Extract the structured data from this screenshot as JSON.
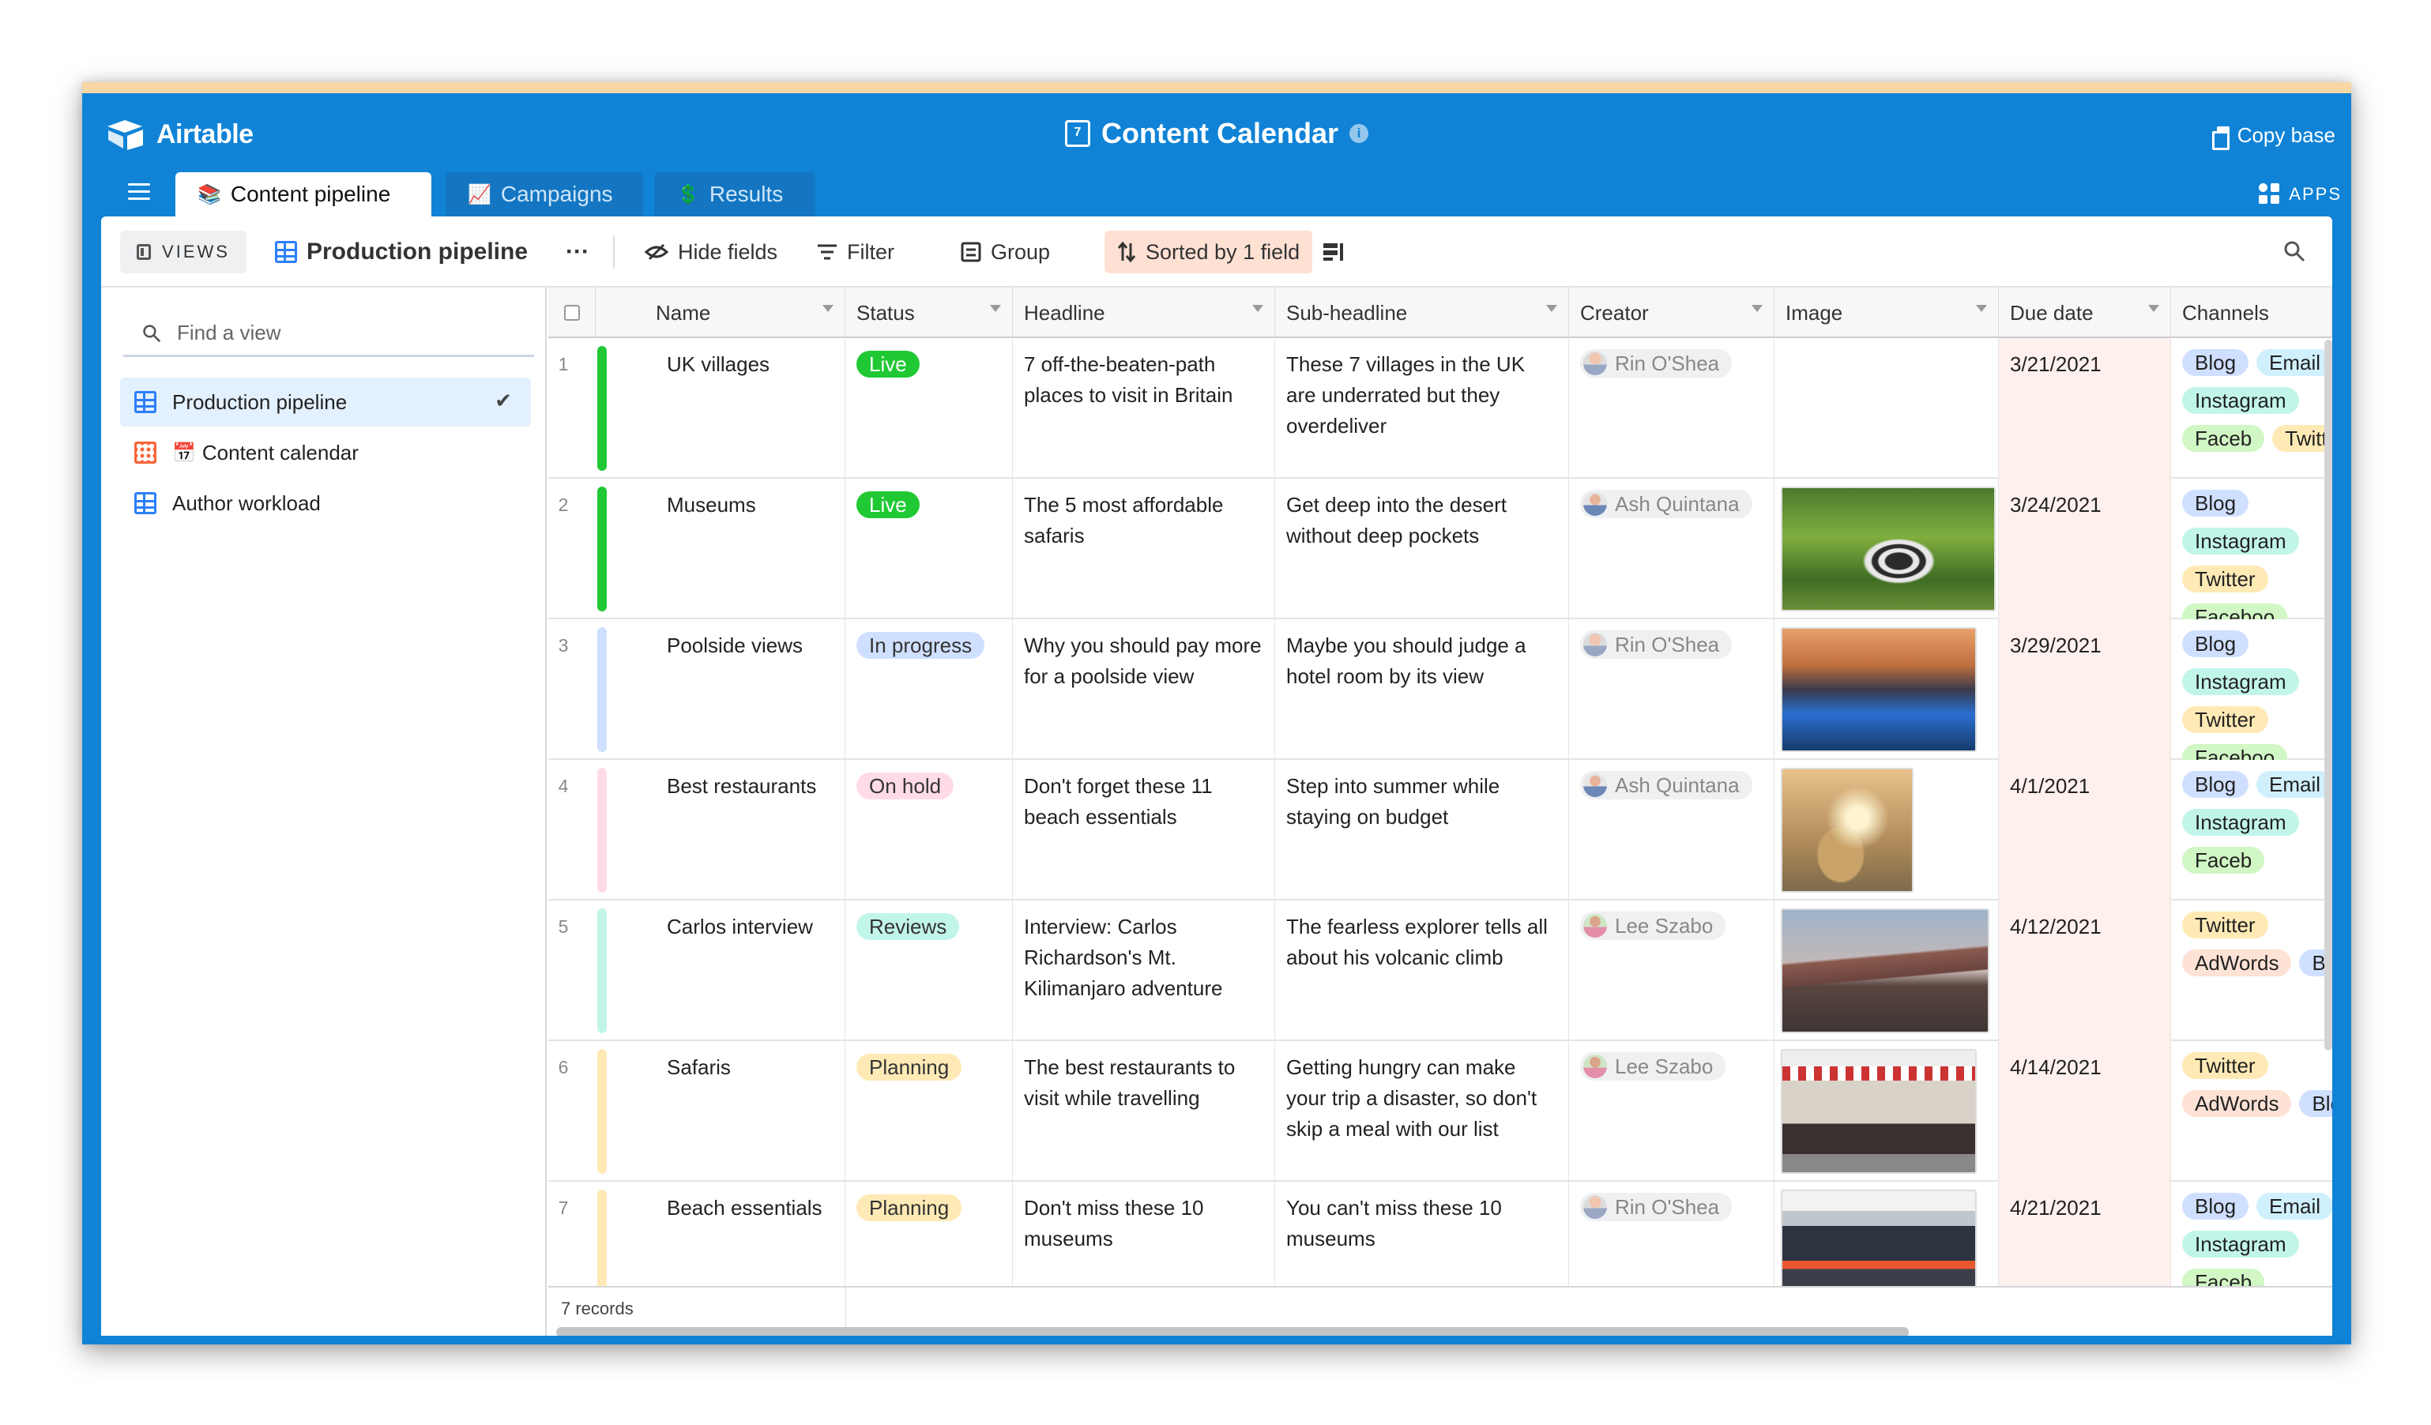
{
  "app": {
    "name": "Airtable",
    "base_title": "Content Calendar",
    "cal_icon_digit": "7",
    "copy_base": "Copy base",
    "apps": "APPS"
  },
  "tabs": [
    {
      "label": "Content pipeline",
      "emoji": "📚"
    },
    {
      "label": "Campaigns",
      "emoji": "📈"
    },
    {
      "label": "Results",
      "emoji": "💲"
    }
  ],
  "toolbar": {
    "views": "VIEWS",
    "view_name": "Production pipeline",
    "more": "···",
    "hide_fields": "Hide fields",
    "filter": "Filter",
    "group": "Group",
    "sorted": "Sorted by 1 field"
  },
  "sidebar": {
    "find_placeholder": "Find a view",
    "items": [
      {
        "label": "Production pipeline",
        "selected": true
      },
      {
        "label": "Content calendar",
        "emoji": "📅"
      },
      {
        "label": "Author workload"
      }
    ]
  },
  "columns": [
    "Name",
    "Status",
    "Headline",
    "Sub-headline",
    "Creator",
    "Image",
    "Due date",
    "Channels"
  ],
  "status_colors": {
    "Live": {
      "bg": "#20c933",
      "fg": "#ffffff"
    },
    "In progress": {
      "bg": "#cfdfff",
      "fg": "#333333"
    },
    "On hold": {
      "bg": "#ffdce5",
      "fg": "#333333"
    },
    "Reviews": {
      "bg": "#c2f5e9",
      "fg": "#333333"
    },
    "Planning": {
      "bg": "#ffeab6",
      "fg": "#333333"
    }
  },
  "channel_colors": {
    "Blog": "#cfdfff",
    "Email": "#d0f0fd",
    "Instagram": "#c2f5e9",
    "Facebook": "#d1f7c4",
    "Twitter": "#ffeab6",
    "AdWords": "#fee2d5"
  },
  "rows": [
    {
      "num": "1",
      "name": "UK villages",
      "status": "Live",
      "bar": "#20c933",
      "headline": "7 off-the-beaten-path places to visit in Britain",
      "sub": "These 7 villages in the UK are underrated but they overdeliver",
      "creator": "Rin O'Shea",
      "image": "",
      "due": "3/21/2021",
      "channels": [
        "Blog",
        "Email",
        "Instagram",
        "Faceb",
        "Twitter"
      ]
    },
    {
      "num": "2",
      "name": "Museums",
      "status": "Live",
      "bar": "#20c933",
      "headline": "The 5 most affordable safaris",
      "sub": "Get deep into the desert without deep pockets",
      "creator": "Ash Quintana",
      "image": "zebras",
      "due": "3/24/2021",
      "channels": [
        "Blog",
        "Instagram",
        "Twitter",
        "Faceboo"
      ]
    },
    {
      "num": "3",
      "name": "Poolside views",
      "status": "In progress",
      "bar": "#cfdfff",
      "headline": "Why you should pay more for a poolside view",
      "sub": "Maybe you should judge a hotel room by its view",
      "creator": "Rin O'Shea",
      "image": "pool",
      "due": "3/29/2021",
      "channels": [
        "Blog",
        "Instagram",
        "Twitter",
        "Faceboo"
      ]
    },
    {
      "num": "4",
      "name": "Best restaurants",
      "status": "On hold",
      "bar": "#ffdce5",
      "headline": "Don't forget these 11 beach essentials",
      "sub": "Step into summer while staying on budget",
      "creator": "Ash Quintana",
      "image": "hat",
      "due": "4/1/2021",
      "channels": [
        "Blog",
        "Email",
        "Instagram",
        "Faceb"
      ]
    },
    {
      "num": "5",
      "name": "Carlos interview",
      "status": "Reviews",
      "bar": "#c2f5e9",
      "headline": "Interview: Carlos Richardson's Mt. Kilimanjaro adventure",
      "sub": "The fearless explorer tells all about his volcanic climb",
      "creator": "Lee Szabo",
      "image": "mountain",
      "due": "4/12/2021",
      "channels": [
        "Twitter",
        "AdWords",
        "Blog"
      ]
    },
    {
      "num": "6",
      "name": "Safaris",
      "status": "Planning",
      "bar": "#ffeab6",
      "headline": "The best restaurants to visit while travelling",
      "sub": "Getting hungry can make your trip a disaster, so don't skip a meal with our list",
      "creator": "Lee Szabo",
      "image": "storefront",
      "due": "4/14/2021",
      "channels": [
        "Twitter",
        "AdWords",
        "Blog"
      ]
    },
    {
      "num": "7",
      "name": "Beach essentials",
      "status": "Planning",
      "bar": "#ffeab6",
      "headline": "Don't miss these 10 museums",
      "sub": "You can't miss these 10 museums",
      "creator": "Rin O'Shea",
      "image": "museum",
      "due": "4/21/2021",
      "channels": [
        "Blog",
        "Email",
        "Instagram",
        "Faceb"
      ]
    }
  ],
  "footer": {
    "records": "7 records"
  }
}
